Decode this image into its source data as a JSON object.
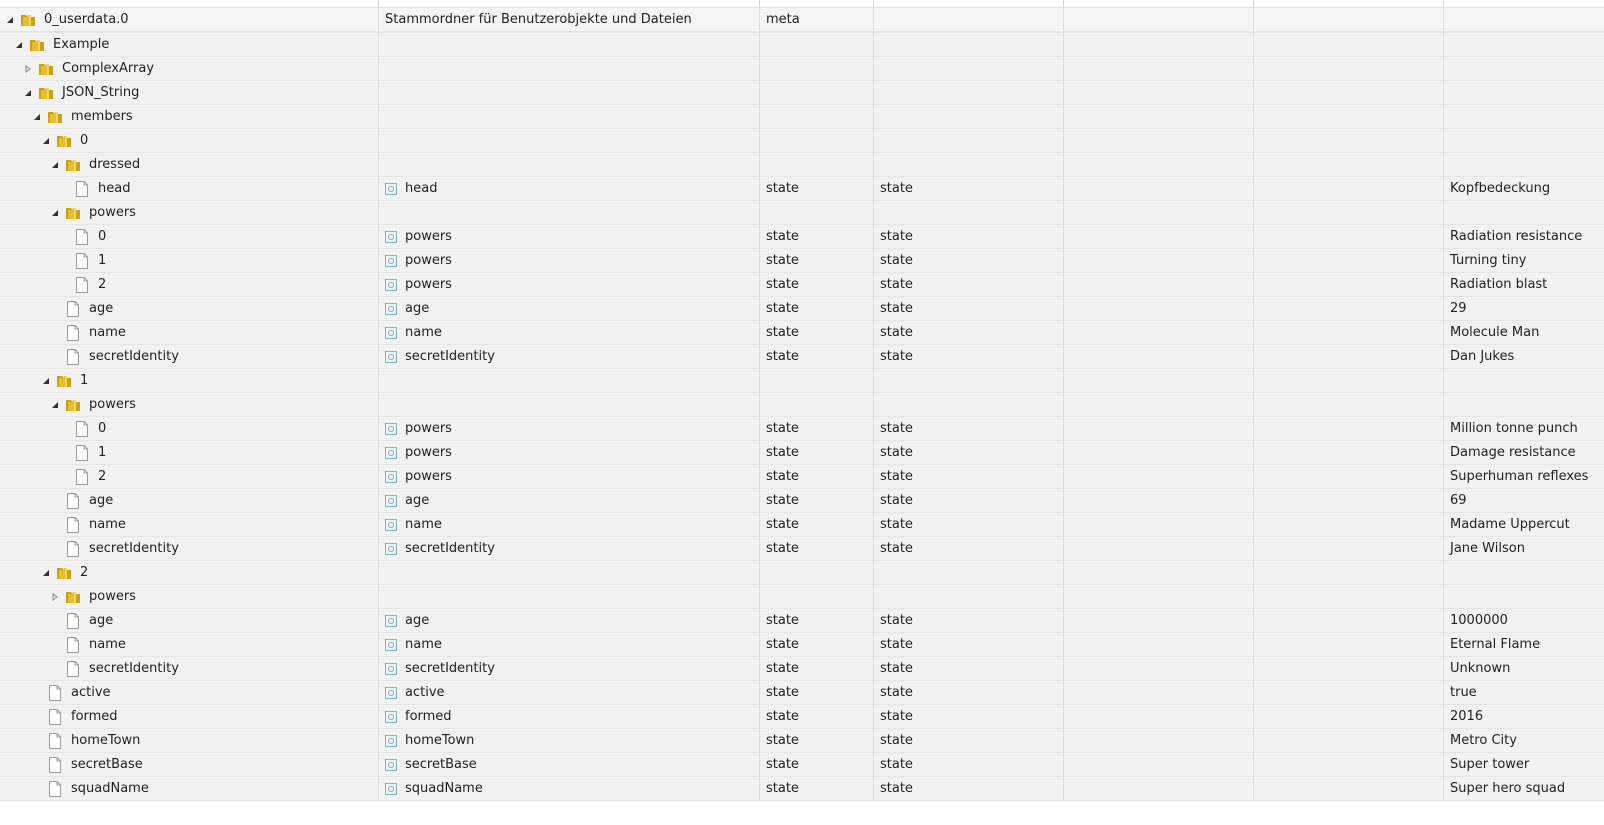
{
  "tree": {
    "rows": [
      {
        "level": 0,
        "kind": "folder",
        "expanded": true,
        "label": "0_userdata.0",
        "name": "Stammordner für Benutzerobjekte und Dateien",
        "type": "meta",
        "role": "",
        "value": "",
        "root": true
      },
      {
        "level": 1,
        "kind": "folder",
        "expanded": true,
        "label": "Example",
        "name": "",
        "type": "",
        "role": "",
        "value": ""
      },
      {
        "level": 2,
        "kind": "folder",
        "expanded": false,
        "label": "ComplexArray",
        "name": "",
        "type": "",
        "role": "",
        "value": ""
      },
      {
        "level": 2,
        "kind": "folder",
        "expanded": true,
        "label": "JSON_String",
        "name": "",
        "type": "",
        "role": "",
        "value": ""
      },
      {
        "level": 3,
        "kind": "folder",
        "expanded": true,
        "label": "members",
        "name": "",
        "type": "",
        "role": "",
        "value": ""
      },
      {
        "level": 4,
        "kind": "folder",
        "expanded": true,
        "label": "0",
        "name": "",
        "type": "",
        "role": "",
        "value": ""
      },
      {
        "level": 5,
        "kind": "folder",
        "expanded": true,
        "label": "dressed",
        "name": "",
        "type": "",
        "role": "",
        "value": ""
      },
      {
        "level": 6,
        "kind": "state",
        "label": "head",
        "name": "head",
        "type": "state",
        "role": "state",
        "value": "Kopfbedeckung"
      },
      {
        "level": 5,
        "kind": "folder",
        "expanded": true,
        "label": "powers",
        "name": "",
        "type": "",
        "role": "",
        "value": ""
      },
      {
        "level": 6,
        "kind": "state",
        "label": "0",
        "name": "powers",
        "type": "state",
        "role": "state",
        "value": "Radiation resistance"
      },
      {
        "level": 6,
        "kind": "state",
        "label": "1",
        "name": "powers",
        "type": "state",
        "role": "state",
        "value": "Turning tiny"
      },
      {
        "level": 6,
        "kind": "state",
        "label": "2",
        "name": "powers",
        "type": "state",
        "role": "state",
        "value": "Radiation blast"
      },
      {
        "level": 5,
        "kind": "state",
        "label": "age",
        "name": "age",
        "type": "state",
        "role": "state",
        "value": "29"
      },
      {
        "level": 5,
        "kind": "state",
        "label": "name",
        "name": "name",
        "type": "state",
        "role": "state",
        "value": "Molecule Man"
      },
      {
        "level": 5,
        "kind": "state",
        "label": "secretIdentity",
        "name": "secretIdentity",
        "type": "state",
        "role": "state",
        "value": "Dan Jukes"
      },
      {
        "level": 4,
        "kind": "folder",
        "expanded": true,
        "label": "1",
        "name": "",
        "type": "",
        "role": "",
        "value": ""
      },
      {
        "level": 5,
        "kind": "folder",
        "expanded": true,
        "label": "powers",
        "name": "",
        "type": "",
        "role": "",
        "value": ""
      },
      {
        "level": 6,
        "kind": "state",
        "label": "0",
        "name": "powers",
        "type": "state",
        "role": "state",
        "value": "Million tonne punch"
      },
      {
        "level": 6,
        "kind": "state",
        "label": "1",
        "name": "powers",
        "type": "state",
        "role": "state",
        "value": "Damage resistance"
      },
      {
        "level": 6,
        "kind": "state",
        "label": "2",
        "name": "powers",
        "type": "state",
        "role": "state",
        "value": "Superhuman reflexes"
      },
      {
        "level": 5,
        "kind": "state",
        "label": "age",
        "name": "age",
        "type": "state",
        "role": "state",
        "value": "69"
      },
      {
        "level": 5,
        "kind": "state",
        "label": "name",
        "name": "name",
        "type": "state",
        "role": "state",
        "value": "Madame Uppercut"
      },
      {
        "level": 5,
        "kind": "state",
        "label": "secretIdentity",
        "name": "secretIdentity",
        "type": "state",
        "role": "state",
        "value": "Jane Wilson"
      },
      {
        "level": 4,
        "kind": "folder",
        "expanded": true,
        "label": "2",
        "name": "",
        "type": "",
        "role": "",
        "value": ""
      },
      {
        "level": 5,
        "kind": "folder",
        "expanded": false,
        "label": "powers",
        "name": "",
        "type": "",
        "role": "",
        "value": ""
      },
      {
        "level": 5,
        "kind": "state",
        "label": "age",
        "name": "age",
        "type": "state",
        "role": "state",
        "value": "1000000"
      },
      {
        "level": 5,
        "kind": "state",
        "label": "name",
        "name": "name",
        "type": "state",
        "role": "state",
        "value": "Eternal Flame"
      },
      {
        "level": 5,
        "kind": "state",
        "label": "secretIdentity",
        "name": "secretIdentity",
        "type": "state",
        "role": "state",
        "value": "Unknown"
      },
      {
        "level": 3,
        "kind": "state",
        "label": "active",
        "name": "active",
        "type": "state",
        "role": "state",
        "value": "true"
      },
      {
        "level": 3,
        "kind": "state",
        "label": "formed",
        "name": "formed",
        "type": "state",
        "role": "state",
        "value": "2016"
      },
      {
        "level": 3,
        "kind": "state",
        "label": "homeTown",
        "name": "homeTown",
        "type": "state",
        "role": "state",
        "value": "Metro City"
      },
      {
        "level": 3,
        "kind": "state",
        "label": "secretBase",
        "name": "secretBase",
        "type": "state",
        "role": "state",
        "value": "Super tower"
      },
      {
        "level": 3,
        "kind": "state",
        "label": "squadName",
        "name": "squadName",
        "type": "state",
        "role": "state",
        "value": "Super hero squad"
      }
    ]
  },
  "icons": {
    "folder": "folder-icon",
    "state": "file-icon",
    "name_marker": "state-object-icon",
    "expand": "triangle-expanded-icon",
    "collapse": "triangle-collapsed-icon"
  },
  "colors": {
    "folder": "#e8c233",
    "folder_dark": "#c9a21a",
    "state_icon": "#7fb3c8"
  }
}
